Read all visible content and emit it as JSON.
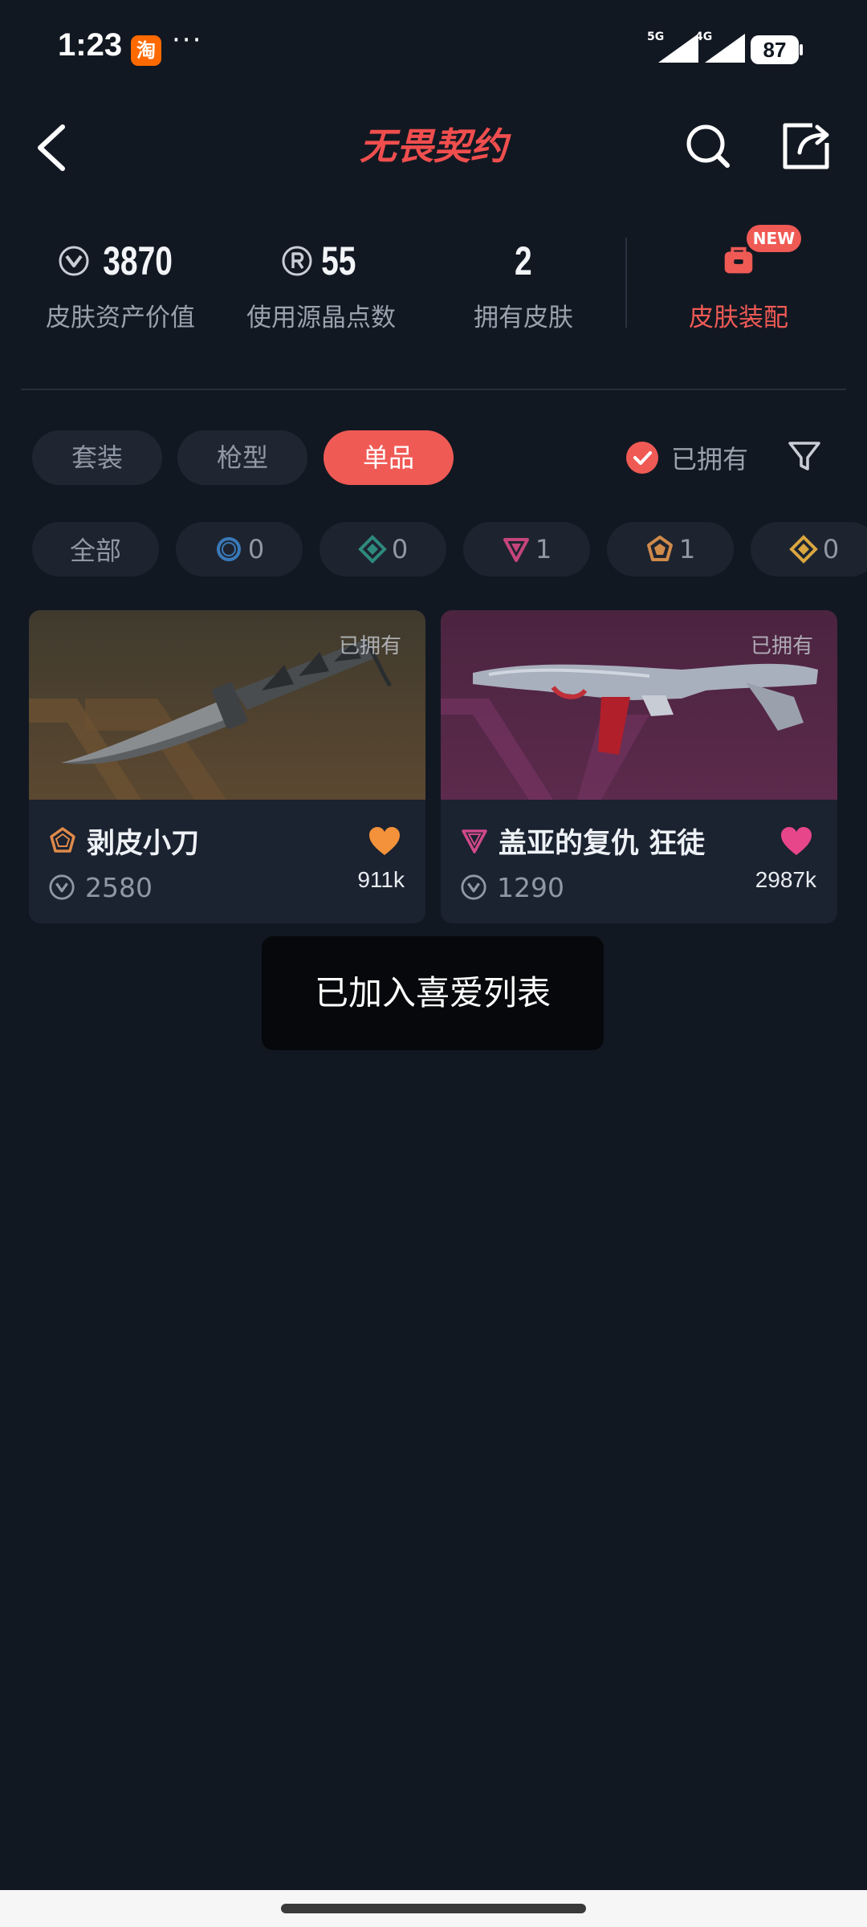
{
  "status_bar": {
    "time": "1:23",
    "app_badge": "淘",
    "more": "···",
    "signal_1_label": "5G",
    "signal_2_label": "4G",
    "battery": "87"
  },
  "header": {
    "title": "无畏契约"
  },
  "stats": [
    {
      "value": "3870",
      "label": "皮肤资产价值",
      "icon": "vp-currency-icon"
    },
    {
      "value": "55",
      "label": "使用源晶点数",
      "icon": "radianite-icon"
    },
    {
      "value": "2",
      "label": "拥有皮肤"
    }
  ],
  "equip": {
    "badge": "NEW",
    "label": "皮肤装配"
  },
  "category_tabs": [
    {
      "label": "套装"
    },
    {
      "label": "枪型"
    },
    {
      "label": "单品",
      "active": true
    }
  ],
  "owned_toggle": {
    "label": "已拥有",
    "checked": true
  },
  "rarity_filters": [
    {
      "label": "全部"
    },
    {
      "count": "0",
      "tier": "select",
      "color": "#3a79b8"
    },
    {
      "count": "0",
      "tier": "deluxe",
      "color": "#2f8a7e"
    },
    {
      "count": "1",
      "tier": "premium",
      "color": "#c4457a"
    },
    {
      "count": "1",
      "tier": "exclusive",
      "color": "#d08a4a"
    },
    {
      "count": "0",
      "tier": "ultra",
      "color": "#d9a640"
    }
  ],
  "cards": [
    {
      "owned": "已拥有",
      "name": "剥皮小刀",
      "price": "2580",
      "likes": "911k",
      "tier_color": "#e08a4a",
      "heart_color": "#f3923a"
    },
    {
      "owned": "已拥有",
      "name": "盖亚的复仇 狂徒",
      "price": "1290",
      "likes": "2987k",
      "tier_color": "#d04a8a",
      "heart_color": "#e8468a"
    }
  ],
  "toast": {
    "text": "已加入喜爱列表"
  },
  "colors": {
    "accent": "#f05a55",
    "background": "#121822",
    "card": "#1b2230"
  }
}
